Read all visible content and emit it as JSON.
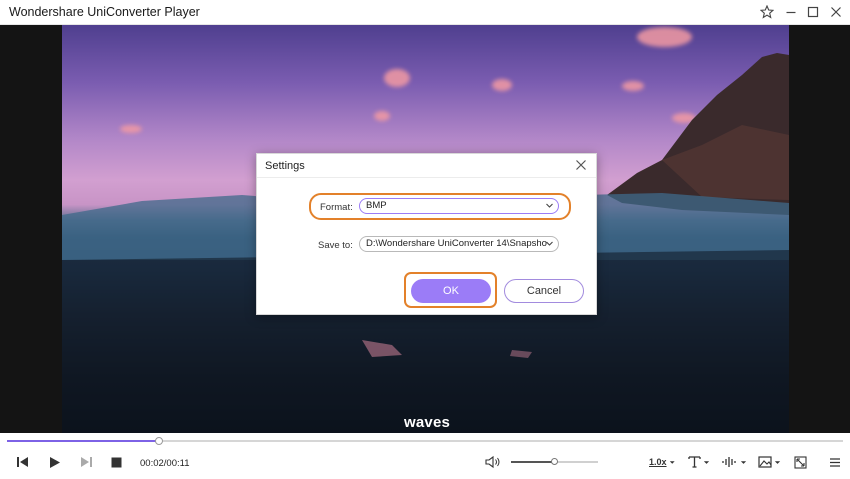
{
  "window": {
    "title": "Wondershare UniConverter Player",
    "pin_icon": "pin-icon",
    "minimize_icon": "minimize-icon",
    "maximize_icon": "maximize-icon",
    "close_icon": "close-icon"
  },
  "video": {
    "subtitle": "waves"
  },
  "settings_dialog": {
    "title": "Settings",
    "format_label": "Format:",
    "format_value": "BMP",
    "save_to_label": "Save to:",
    "save_to_value": "D:\\Wondershare UniConverter 14\\Snapsho",
    "ok_label": "OK",
    "cancel_label": "Cancel",
    "highlight_color": "#e3812a",
    "ok_color": "#9b7cf7"
  },
  "player": {
    "current_time": "00:02",
    "total_time": "00:11",
    "time_display": "00:02/00:11",
    "progress_fraction": 0.182,
    "volume_fraction": 0.5,
    "speed_label": "1.0x",
    "accent_color": "#7d62e6"
  }
}
